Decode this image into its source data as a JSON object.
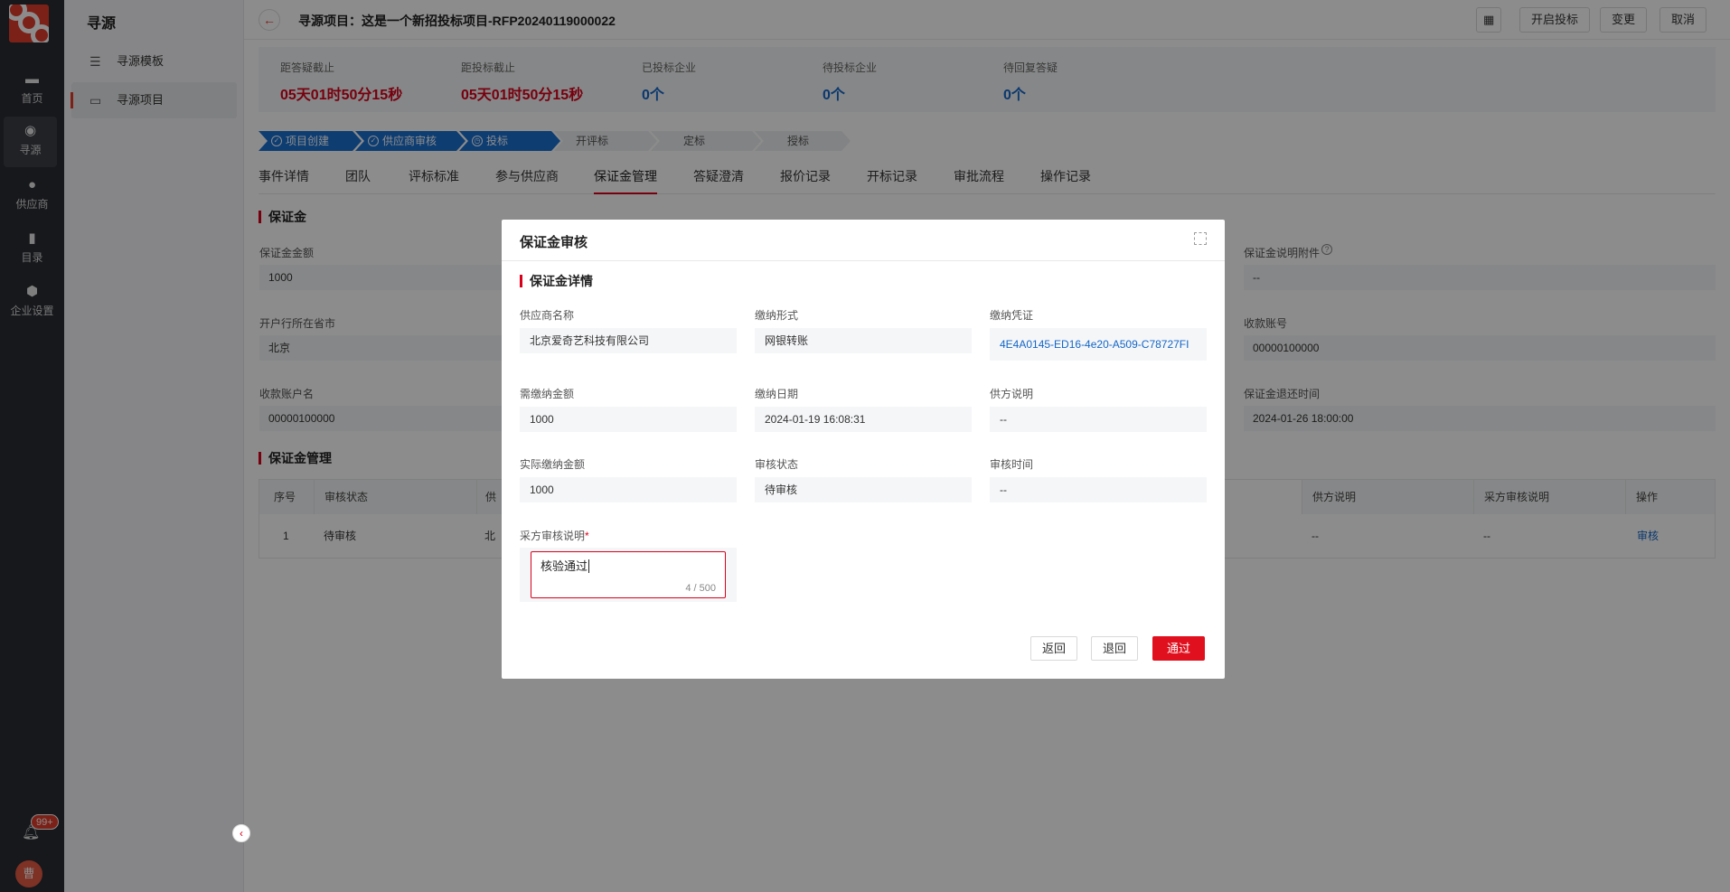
{
  "leftnav": {
    "items": [
      {
        "label": "首页",
        "icon": "home-icon"
      },
      {
        "label": "寻源",
        "icon": "sourcing-icon"
      },
      {
        "label": "供应商",
        "icon": "supplier-icon"
      },
      {
        "label": "目录",
        "icon": "catalog-icon"
      },
      {
        "label": "企业设置",
        "icon": "settings-icon"
      }
    ],
    "badge": "99+",
    "avatar": "曹"
  },
  "subnav": {
    "title": "寻源",
    "items": [
      {
        "label": "寻源模板"
      },
      {
        "label": "寻源项目"
      }
    ]
  },
  "header": {
    "title": "寻源项目：这是一个新招投标项目-RFP20240119000022",
    "buttons": {
      "open_bid": "开启投标",
      "change": "变更",
      "cancel": "取消"
    }
  },
  "stats": [
    {
      "label": "距答疑截止",
      "value": "05天01时50分15秒",
      "color": "#d9001b"
    },
    {
      "label": "距投标截止",
      "value": "05天01时50分15秒",
      "color": "#d9001b"
    },
    {
      "label": "已投标企业",
      "value": "0个",
      "color": "#1366c8"
    },
    {
      "label": "待投标企业",
      "value": "0个",
      "color": "#1366c8"
    },
    {
      "label": "待回复答疑",
      "value": "0个",
      "color": "#1366c8"
    }
  ],
  "steps": [
    {
      "label": "项目创建",
      "state": "done"
    },
    {
      "label": "供应商审核",
      "state": "done"
    },
    {
      "label": "投标",
      "state": "current"
    },
    {
      "label": "开评标",
      "state": "todo"
    },
    {
      "label": "定标",
      "state": "todo"
    },
    {
      "label": "授标",
      "state": "todo"
    }
  ],
  "tabs": [
    "事件详情",
    "团队",
    "评标标准",
    "参与供应商",
    "保证金管理",
    "答疑澄清",
    "报价记录",
    "开标记录",
    "审批流程",
    "操作记录"
  ],
  "active_tab": "保证金管理",
  "deposit": {
    "section": "保证金",
    "amount_label": "保证金金额",
    "amount": "1000",
    "province_label": "开户行所在省市",
    "province": "北京",
    "account_name_label": "收款账户名",
    "account_name": "00000100000",
    "attachment_label": "保证金说明附件",
    "attachment": "--",
    "account_no_label": "收款账号",
    "account_no": "00000100000",
    "return_time_label": "保证金退还时间",
    "return_time": "2024-01-26 18:00:00"
  },
  "deposit_table": {
    "section": "保证金管理",
    "headers": {
      "index": "序号",
      "status": "审核状态",
      "supplier": "供",
      "supplier_note": "供方说明",
      "buyer_note": "采方审核说明",
      "action": "操作"
    },
    "row": {
      "index": "1",
      "status": "待审核",
      "supplier": "北",
      "supplier_note": "--",
      "buyer_note": "--",
      "action": "审核"
    }
  },
  "modal": {
    "title": "保证金审核",
    "section": "保证金详情",
    "fields": {
      "supplier_name_label": "供应商名称",
      "supplier_name": "北京爱奇艺科技有限公司",
      "pay_form_label": "缴纳形式",
      "pay_form": "网银转账",
      "voucher_label": "缴纳凭证",
      "voucher": "4E4A0145-ED16-4e20-A509-C78727FI",
      "required_amount_label": "需缴纳金额",
      "required_amount": "1000",
      "pay_date_label": "缴纳日期",
      "pay_date": "2024-01-19 16:08:31",
      "supplier_note_label": "供方说明",
      "supplier_note": "--",
      "actual_amount_label": "实际缴纳金额",
      "actual_amount": "1000",
      "review_status_label": "审核状态",
      "review_status": "待审核",
      "review_time_label": "审核时间",
      "review_time": "--",
      "buyer_note_label": "采方审核说明",
      "required_mark": "*",
      "buyer_note_value": "核验通过",
      "counter": "4 / 500"
    },
    "buttons": {
      "back": "返回",
      "reject": "退回",
      "approve": "通过"
    }
  }
}
